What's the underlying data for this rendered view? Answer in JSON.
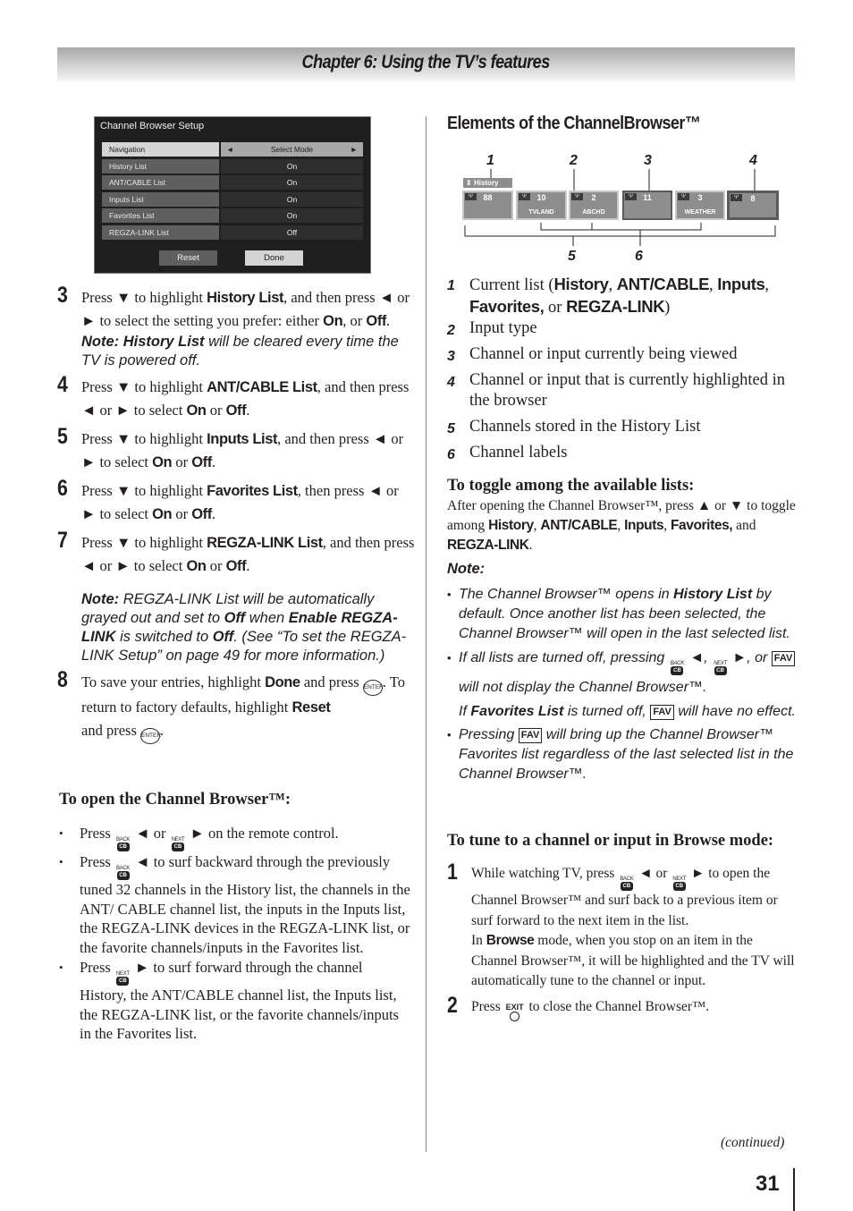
{
  "header": {
    "chapter_title": "Chapter 6: Using the TV’s features"
  },
  "setup_menu": {
    "title": "Channel Browser Setup",
    "rows": [
      {
        "label": "Navigation",
        "value": "Select Mode",
        "arrow_left": "◄",
        "arrow_right": "►"
      },
      {
        "label": "History List",
        "value": "On"
      },
      {
        "label": "ANT/CABLE List",
        "value": "On"
      },
      {
        "label": "Inputs List",
        "value": "On"
      },
      {
        "label": "Favorites List",
        "value": "On"
      },
      {
        "label": "REGZA-LINK List",
        "value": "Off"
      }
    ],
    "reset_label": "Reset",
    "done_label": "Done"
  },
  "left_steps": [
    {
      "num": "3",
      "t1": "Press ▼ to highlight ",
      "b1": "History List",
      "t2": ", and then press ◄ or ► to select the setting you prefer: either ",
      "b2": "On",
      "t3": ", or ",
      "b3": "Off",
      "t4": ".",
      "note_b1": "Note: History List",
      "note_t1": " will be cleared every time the TV is powered off."
    },
    {
      "num": "4",
      "t1": "Press ▼ to highlight ",
      "b1": "ANT/CABLE List",
      "t2": ", and then press ◄ or ► to select ",
      "b2": "On",
      "t3": " or ",
      "b3": "Off",
      "t4": "."
    },
    {
      "num": "5",
      "t1": "Press ▼ to highlight ",
      "b1": "Inputs List",
      "t2": ", and then press ◄ or ► to select ",
      "b2": "On",
      "t3": " or ",
      "b3": "Off",
      "t4": "."
    },
    {
      "num": "6",
      "t1": "Press ▼ to highlight ",
      "b1": "Favorites List",
      "t2": ", then press ◄ or ► to select ",
      "b2": "On",
      "t3": " or ",
      "b3": "Off",
      "t4": "."
    },
    {
      "num": "7",
      "t1": "Press ▼ to highlight ",
      "b1": "REGZA-LINK List",
      "t2": ", and then press ◄ or ► to select ",
      "b2": "On",
      "t3": " or ",
      "b3": "Off",
      "t4": ".",
      "note_b1": "Note:",
      "note_t1": " REGZA-LINK List will be automatically grayed out and set to ",
      "note_b2": "Off",
      "note_t2": " when ",
      "note_b3": "Enable REGZA-LINK",
      "note_t3": " is switched to ",
      "note_b4": "Off",
      "note_t4": ". (See “To set the REGZA-LINK Setup” on page 49 for more information.)"
    },
    {
      "num": "8",
      "t1": "To save your entries, highlight ",
      "b1": "Done",
      "t2": " and press ",
      "t3": ". To return to factory defaults, highlight ",
      "b2": "Reset",
      "t4": " and press ",
      "t5": "."
    }
  ],
  "open_browser": {
    "heading": "To open the Channel Browser™:",
    "bullets": [
      {
        "t1": "Press ",
        "t2": " ◄ or ",
        "t3": " ► on the remote control."
      },
      {
        "t1": "Press ",
        "t2": " ◄ to surf backward through the previously tuned 32 channels in the History list, the channels in the ANT/ CABLE channel list, the inputs in the Inputs list, the REGZA-LINK devices in the REGZA-LINK list, or the favorite channels/inputs in the Favorites list."
      },
      {
        "t1": "Press ",
        "t2": " ► to surf forward through the channel History, the ANT/CABLE channel list, the Inputs list, the REGZA-LINK list, or the favorite channels/inputs in the Favorites list."
      }
    ]
  },
  "icons": {
    "back_caption": "BACK",
    "next_caption": "NEXT",
    "cb": "CB",
    "enter": "ENTER",
    "fav": "FAV",
    "exit": "EXIT",
    "antenna": "Ψ"
  },
  "elements": {
    "title": "Elements of the ChannelBrowser™",
    "diagram": {
      "callouts_top": [
        "1",
        "2",
        "3",
        "4"
      ],
      "callouts_bottom": [
        "5",
        "6"
      ],
      "list_tag": "History",
      "tag_arrows": "⇕",
      "tiles": [
        {
          "channel": "88",
          "label": ""
        },
        {
          "channel": "10",
          "label": "TVLAND"
        },
        {
          "channel": "2",
          "label": "ABCHD"
        },
        {
          "channel": "11",
          "label": ""
        },
        {
          "channel": "3",
          "label": "WEATHER"
        },
        {
          "channel": "8",
          "label": ""
        }
      ]
    },
    "legend": [
      {
        "num": "1",
        "t1": "Current list (",
        "b1": "History",
        "t2": ", ",
        "b2": "ANT/CABLE",
        "t3": ", ",
        "b3": "Inputs",
        "t4": ", ",
        "b4": "Favorites,",
        "t5": " or ",
        "b5": "REGZA-LINK",
        "t6": ")"
      },
      {
        "num": "2",
        "text": "Input type"
      },
      {
        "num": "3",
        "text": "Channel or input currently being viewed"
      },
      {
        "num": "4",
        "text": "Channel or input that is currently highlighted in the browser"
      },
      {
        "num": "5",
        "text": "Channels stored in the History List"
      },
      {
        "num": "6",
        "text": "Channel labels"
      }
    ]
  },
  "toggle": {
    "heading": "To toggle among the available lists:",
    "t1": "After opening the Channel Browser™, press ▲ or ▼ to toggle among ",
    "b1": "History",
    "t2": ", ",
    "b2": "ANT/CABLE",
    "t3": ", ",
    "b3": "Inputs",
    "t4": ", ",
    "b4": "Favorites,",
    "t5": " and ",
    "b5": "REGZA-LINK",
    "t6": ".",
    "note_title": "Note:",
    "notes": [
      {
        "t1": "The Channel Browser™ opens in ",
        "b1": "History List",
        "t2": " by default. Once another list has been selected, the Channel Browser™ will open in the last selected list."
      },
      {
        "t1": "If all lists are turned off, pressing ",
        "t2": " ◄, ",
        "t3": " ►, or ",
        "t4": " will not display the Channel Browser™.",
        "t5": "If ",
        "b1": "Favorites List",
        "t6": " is turned off, ",
        "t7": " will have no effect."
      },
      {
        "t1": "Pressing ",
        "t2": " will bring up the Channel Browser™ Favorites list regardless of the last selected list in the Channel Browser™."
      }
    ]
  },
  "tune": {
    "heading": "To tune to a channel or input in Browse mode:",
    "steps": [
      {
        "num": "1",
        "t1": "While watching TV, press ",
        "t2": " ◄ or ",
        "t3": " ► to open the Channel Browser™ and surf back to a previous item or surf forward to the next item in the list.",
        "t4": "In ",
        "b1": "Browse",
        "t5": " mode, when you stop on an item in the Channel Browser™, it will be highlighted and the TV will automatically tune to the channel or input."
      },
      {
        "num": "2",
        "t1": "Press ",
        "t2": " to close the Channel Browser™."
      }
    ]
  },
  "footer": {
    "continued": "(continued)",
    "page_number": "31"
  }
}
